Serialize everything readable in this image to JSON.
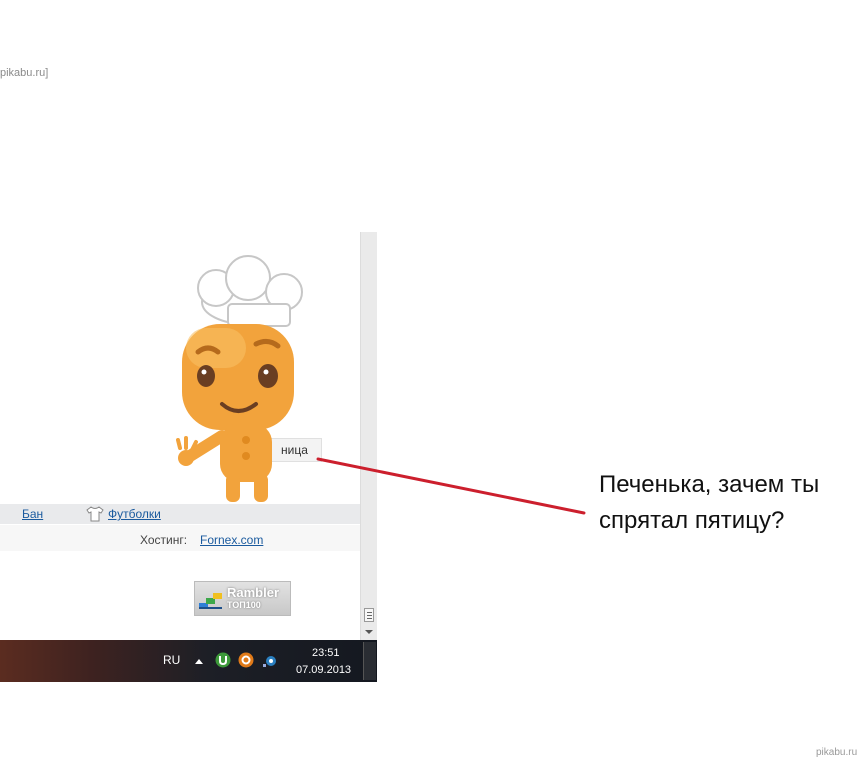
{
  "source_tag": "pikabu.ru]",
  "links": {
    "ban": "Бан",
    "shirts": "Футболки"
  },
  "hosting": {
    "label": "Хостинг:",
    "link": "Fornex.com"
  },
  "rambler": {
    "word": "Rambler",
    "sub": "ТОП100"
  },
  "tooltip_text": "ница",
  "taskbar": {
    "lang": "RU",
    "time": "23:51",
    "date": "07.09.2013"
  },
  "caption": {
    "line1": "Печенька, зачем ты",
    "line2": "спрятал пятицу?"
  },
  "watermark": "pikabu.ru",
  "colors": {
    "link": "#1a5a9e",
    "pointer_line": "#cc1f2d",
    "mascot_body": "#f2a33c"
  },
  "icons": [
    "tshirt-icon",
    "rambler-stairs-icon",
    "utorrent-icon",
    "orange-tray-icon",
    "network-tray-icon",
    "cookie-chef-mascot"
  ]
}
